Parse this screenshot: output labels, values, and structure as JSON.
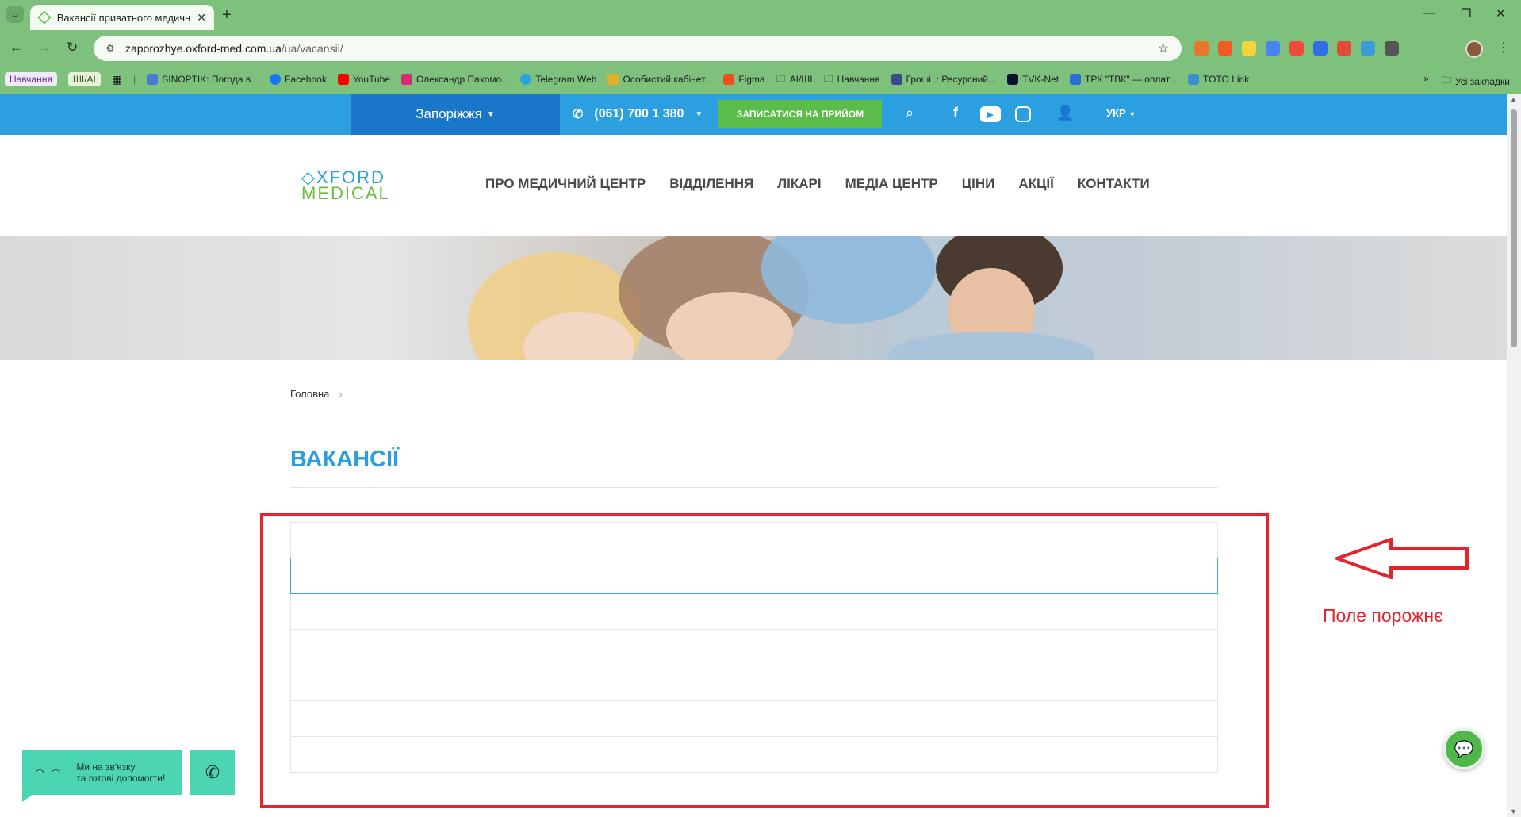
{
  "browser": {
    "tab_title": "Вакансії приватного медичного",
    "url_host": "zaporozhye.oxford-med.com.ua",
    "url_path": "/ua/vacansii/",
    "bookmarks": [
      {
        "label": "SINOPTIK: Погода в...",
        "color": "#4a7bd4"
      },
      {
        "label": "Facebook",
        "color": "#1877f2"
      },
      {
        "label": "YouTube",
        "color": "#ff0000"
      },
      {
        "label": "Олександр Пахомо...",
        "color": "#d62976"
      },
      {
        "label": "Telegram Web",
        "color": "#2aa3e0"
      },
      {
        "label": "Особистий кабінет...",
        "color": "#e0b02a"
      },
      {
        "label": "Figma",
        "color": "#f24e1e"
      },
      {
        "label": "AI/ШІ",
        "color": "folder"
      },
      {
        "label": "Навчання",
        "color": "folder"
      },
      {
        "label": "Гроші .: Ресурсний...",
        "color": "#3a4a8a"
      },
      {
        "label": "TVK-Net",
        "color": "#111133"
      },
      {
        "label": "ТРК \"ТВК\" — оплат...",
        "color": "#2a6fd6"
      },
      {
        "label": "TOTO Link",
        "color": "#3a8fd0"
      }
    ],
    "bookmark_tags": [
      "Навчання",
      "ШІ/AI"
    ],
    "all_bookmarks": "Усі закладки"
  },
  "topbar": {
    "city": "Запоріжжя",
    "phone": "(061) 700 1 380",
    "appointment": "ЗАПИСАТИСЯ НА ПРИЙОМ",
    "lang": "УКР",
    "color_bar": "#2c9fe1",
    "color_city": "#1976c8",
    "color_button": "#5cbc49"
  },
  "logo": {
    "line1": "◇XFORD",
    "line2": "MEDICAL"
  },
  "nav": [
    "ПРО МЕДИЧНИЙ ЦЕНТР",
    "ВІДДІЛЕННЯ",
    "ЛІКАРІ",
    "МЕДІА ЦЕНТР",
    "ЦІНИ",
    "АКЦІЇ",
    "КОНТАКТИ"
  ],
  "breadcrumb": {
    "home": "Головна"
  },
  "page": {
    "title": "ВАКАНСІЇ"
  },
  "annotation": {
    "text": "Поле порожнє",
    "color": "#e3242b"
  },
  "widgets": {
    "chat_line1": "Ми на зв'язку",
    "chat_line2": "та готові допомогти!",
    "chat_face": "◠ ◠"
  }
}
